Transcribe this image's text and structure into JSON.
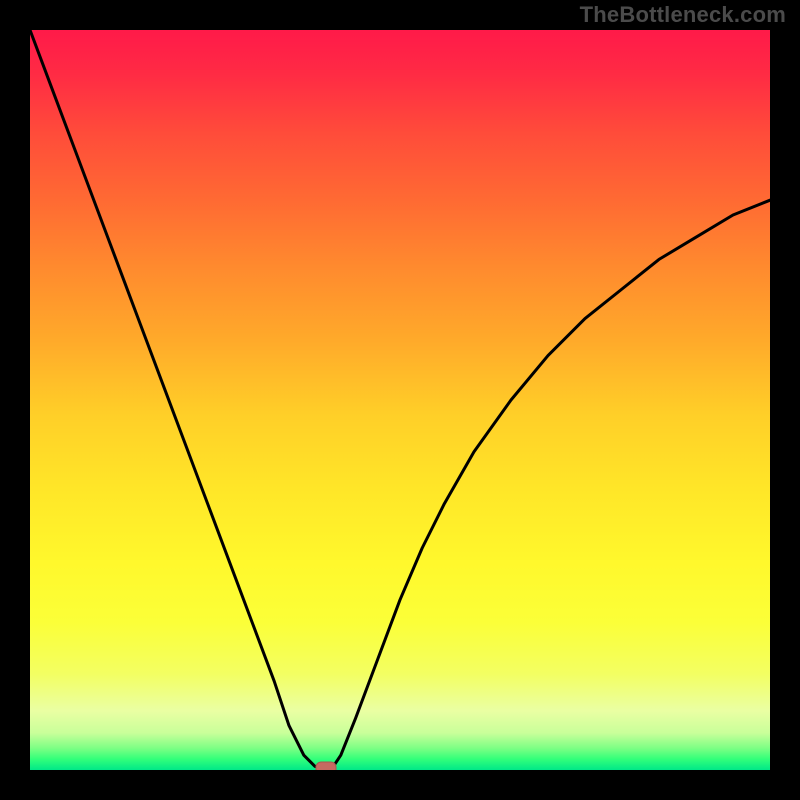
{
  "watermark": "TheBottleneck.com",
  "palette": {
    "background": "#000000",
    "curve": "#000000",
    "marker_fill": "#c66a61",
    "marker_stroke": "#a7594f",
    "gradient_stops": [
      {
        "offset": 0.0,
        "color": "#ff1a49"
      },
      {
        "offset": 0.06,
        "color": "#ff2b44"
      },
      {
        "offset": 0.14,
        "color": "#ff4c3a"
      },
      {
        "offset": 0.23,
        "color": "#ff6a33"
      },
      {
        "offset": 0.32,
        "color": "#ff8a2e"
      },
      {
        "offset": 0.42,
        "color": "#ffaa2a"
      },
      {
        "offset": 0.52,
        "color": "#ffcf28"
      },
      {
        "offset": 0.62,
        "color": "#ffe628"
      },
      {
        "offset": 0.72,
        "color": "#fff82c"
      },
      {
        "offset": 0.8,
        "color": "#fbff38"
      },
      {
        "offset": 0.87,
        "color": "#f3ff62"
      },
      {
        "offset": 0.92,
        "color": "#eaffa3"
      },
      {
        "offset": 0.95,
        "color": "#c9ff9a"
      },
      {
        "offset": 0.97,
        "color": "#7fff85"
      },
      {
        "offset": 0.985,
        "color": "#33ff7a"
      },
      {
        "offset": 1.0,
        "color": "#00e888"
      }
    ]
  },
  "chart_data": {
    "type": "line",
    "title": "",
    "xlabel": "",
    "ylabel": "",
    "xlim": [
      0,
      100
    ],
    "ylim": [
      0,
      100
    ],
    "series": [
      {
        "name": "bottleneck-curve",
        "x": [
          0,
          3,
          6,
          9,
          12,
          15,
          18,
          21,
          24,
          27,
          30,
          33,
          35,
          37,
          38.5,
          40,
          41,
          42,
          44,
          47,
          50,
          53,
          56,
          60,
          65,
          70,
          75,
          80,
          85,
          90,
          95,
          100
        ],
        "y_percent": [
          100,
          92,
          84,
          76,
          68,
          60,
          52,
          44,
          36,
          28,
          20,
          12,
          6,
          2,
          0.5,
          0,
          0.5,
          2,
          7,
          15,
          23,
          30,
          36,
          43,
          50,
          56,
          61,
          65,
          69,
          72,
          75,
          77
        ]
      }
    ],
    "marker": {
      "x": 40,
      "y_percent": 0
    },
    "notes": "V-shaped bottleneck profile; minimum (optimal match) at x≈40 where value≈0. Left branch is near-linear descent from 100 to 0; right branch is a concave rising curve saturating towards ~77 at x=100."
  }
}
